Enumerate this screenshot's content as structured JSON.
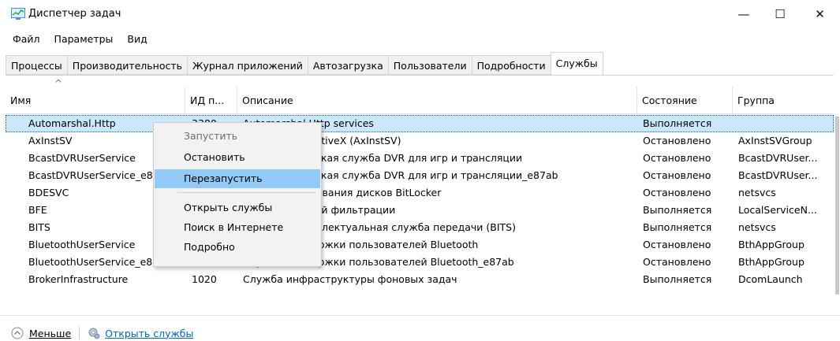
{
  "window": {
    "title": "Диспетчер задач",
    "minimize_glyph": "—",
    "maximize_glyph": "☐",
    "close_glyph": "✕"
  },
  "menu": [
    "Файл",
    "Параметры",
    "Вид"
  ],
  "tabs": [
    "Процессы",
    "Производительность",
    "Журнал приложений",
    "Автозагрузка",
    "Пользователи",
    "Подробности",
    "Службы"
  ],
  "active_tab": "Службы",
  "columns": {
    "name": "Имя",
    "pid": "ИД п...",
    "description": "Описание",
    "state": "Состояние",
    "group": "Группа",
    "sort_glyph": "^"
  },
  "rows": [
    {
      "name": "Automarshal.Http",
      "pid": "3380",
      "description": "Automarshal.Http services",
      "state": "Выполняется",
      "group": ""
    },
    {
      "name": "AxInstSV",
      "pid": "",
      "description": "Установщик ActiveX (AxInstSV)",
      "state": "Остановлено",
      "group": "AxInstSVGroup"
    },
    {
      "name": "BcastDVRUserService",
      "pid": "",
      "description": "Пользовательская служба DVR для игр и трансляции",
      "state": "Остановлено",
      "group": "BcastDVRUser..."
    },
    {
      "name": "BcastDVRUserService_e87ab",
      "pid": "",
      "description": "Пользовательская служба DVR для игр и трансляции_e87ab",
      "state": "Остановлено",
      "group": "BcastDVRUser..."
    },
    {
      "name": "BDESVC",
      "pid": "",
      "description": "Служба шифрования дисков BitLocker",
      "state": "Остановлено",
      "group": "netsvcs"
    },
    {
      "name": "BFE",
      "pid": "",
      "description": "Служба базовой фильтрации",
      "state": "Выполняется",
      "group": "LocalServiceN..."
    },
    {
      "name": "BITS",
      "pid": "",
      "description": "Фоновая интеллектуальная служба передачи (BITS)",
      "state": "Выполняется",
      "group": "netsvcs"
    },
    {
      "name": "BluetoothUserService",
      "pid": "",
      "description": "Служба поддержки пользователей Bluetooth",
      "state": "Остановлено",
      "group": "BthAppGroup"
    },
    {
      "name": "BluetoothUserService_e87ab",
      "pid": "",
      "description": "Служба поддержки пользователей Bluetooth_e87ab",
      "state": "Остановлено",
      "group": "BthAppGroup"
    },
    {
      "name": "BrokerInfrastructure",
      "pid": "1020",
      "description": "Служба инфраструктуры фоновых задач",
      "state": "Выполняется",
      "group": "DcomLaunch"
    }
  ],
  "context_menu": {
    "start": "Запустить",
    "stop": "Остановить",
    "restart": "Перезапустить",
    "open_services": "Открыть службы",
    "search_online": "Поиск в Интернете",
    "details": "Подробно"
  },
  "footer": {
    "fewer_label": "Меньше",
    "open_services_label": "Открыть службы"
  },
  "colors": {
    "selection": "#cce8ff",
    "menu_hover": "#91c9f7",
    "link": "#0066cc"
  }
}
